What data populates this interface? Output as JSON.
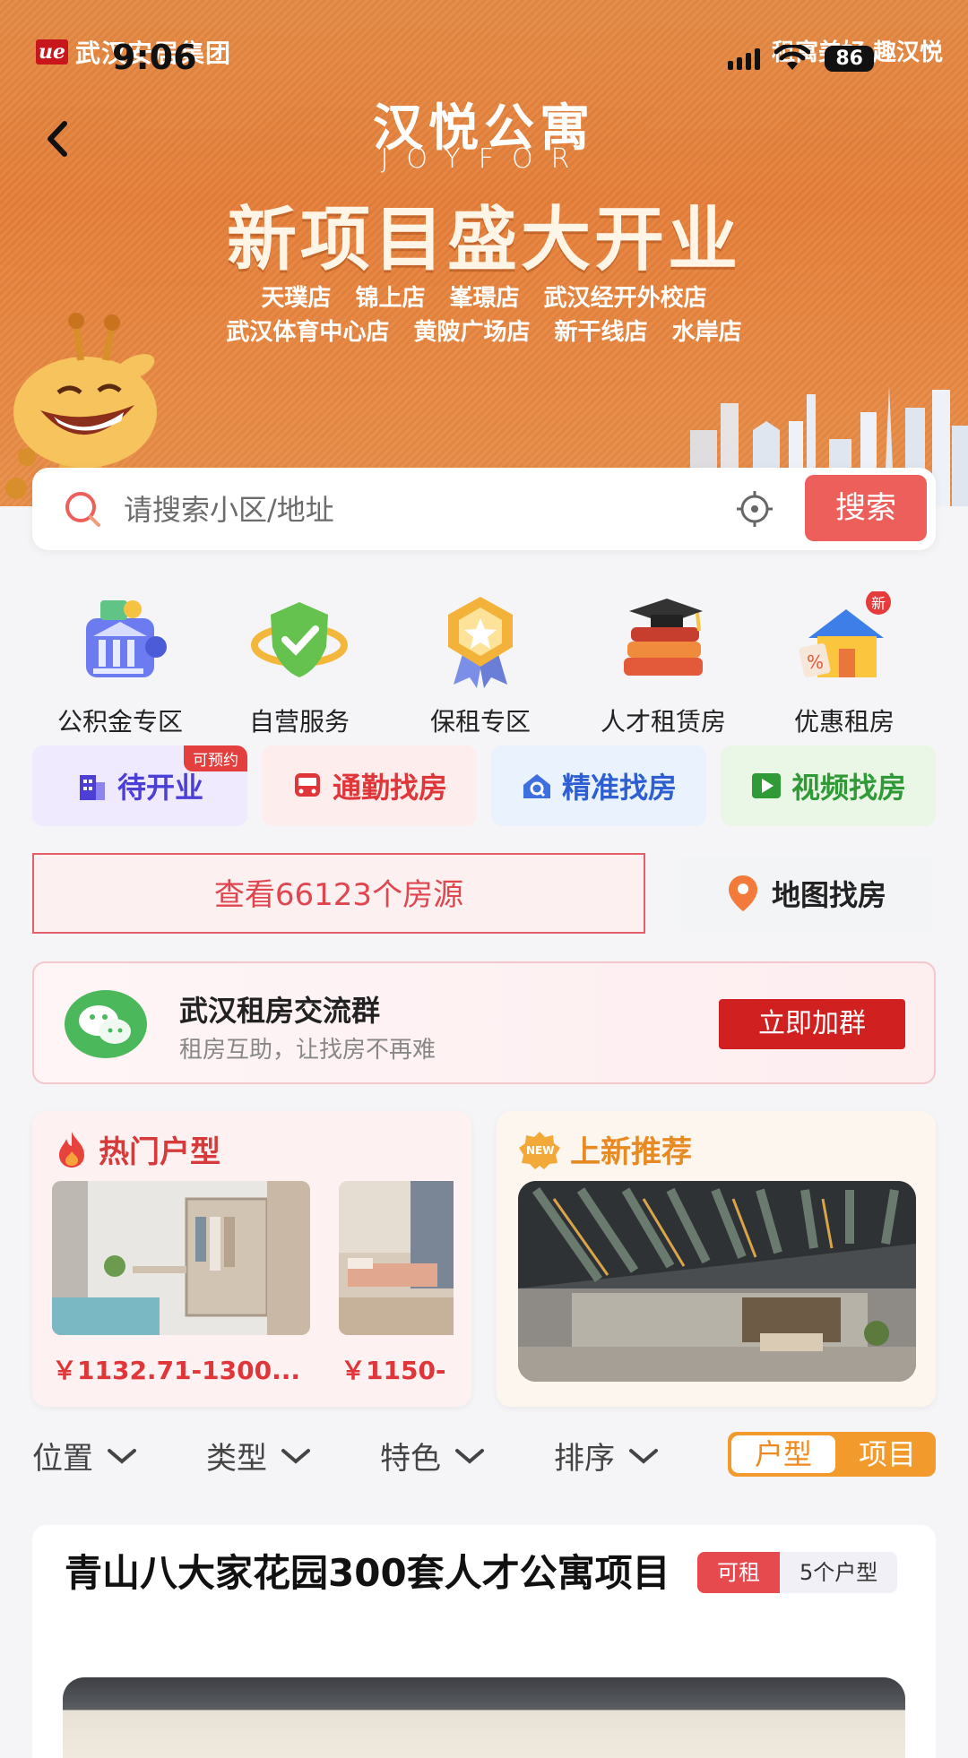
{
  "status_bar": {
    "time": "9:06",
    "battery": "86"
  },
  "banner": {
    "logo_text": "武汉安居集团",
    "slogan": "租寓美好 趣汉悦",
    "brand_cn": "汉悦公寓",
    "brand_en": "JOYFOR",
    "headline": "新项目盛大开业",
    "stores_line1": "天璞店 锦上店 峯璟店 武汉经开外校店",
    "stores_line2": "武汉体育中心店 黄陂广场店 新干线店 水岸店"
  },
  "search": {
    "placeholder": "请搜索小区/地址",
    "button": "搜索"
  },
  "categories": [
    {
      "label": "公积金专区",
      "icon": "bank-safe-icon"
    },
    {
      "label": "自营服务",
      "icon": "shield-check-icon"
    },
    {
      "label": "保租专区",
      "icon": "medal-icon"
    },
    {
      "label": "人才租赁房",
      "icon": "books-cap-icon"
    },
    {
      "label": "优惠租房",
      "icon": "discount-house-icon",
      "badge": "新"
    }
  ],
  "finders": [
    {
      "label": "待开业",
      "badge": "可预约",
      "color": "#4b3fd6"
    },
    {
      "label": "通勤找房",
      "color": "#e0363a"
    },
    {
      "label": "精准找房",
      "color": "#2d5fd3"
    },
    {
      "label": "视频找房",
      "color": "#2f9a36"
    }
  ],
  "listings_count_button": "查看66123个房源",
  "map_button": "地图找房",
  "wechat_group": {
    "title": "武汉租房交流群",
    "subtitle": "租房互助，让找房不再难",
    "button": "立即加群"
  },
  "hot_types": {
    "title": "热门户型",
    "prices": [
      "￥1132.71-1300...",
      "￥1150-"
    ]
  },
  "new_picks": {
    "title": "上新推荐",
    "badge": "NEW"
  },
  "filters": [
    "位置",
    "类型",
    "特色",
    "排序"
  ],
  "view_toggle": {
    "active": "户型",
    "inactive": "项目"
  },
  "listing": {
    "title": "青山八大家花园300套人才公寓项目",
    "status": "可租",
    "unit_count": "5个户型"
  }
}
